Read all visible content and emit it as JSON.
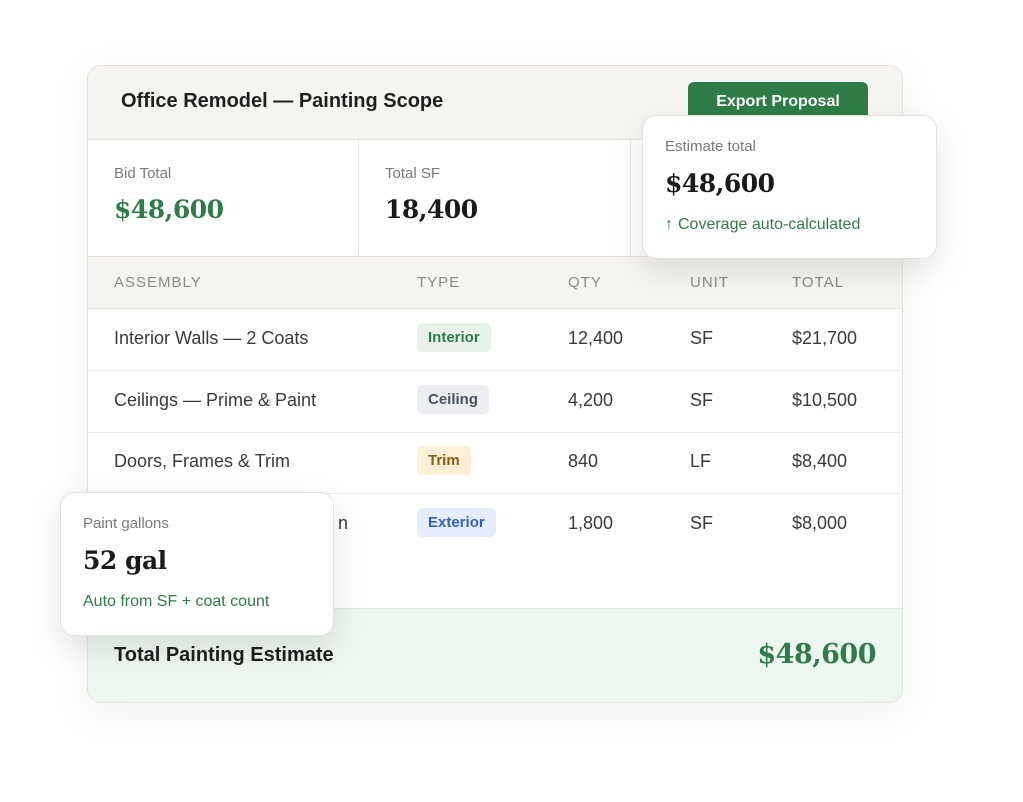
{
  "header": {
    "title": "Office Remodel — Painting Scope",
    "export_label": "Export Proposal"
  },
  "stats": [
    {
      "label": "Bid Total",
      "value": "$48,600"
    },
    {
      "label": "Total SF",
      "value": "18,400"
    }
  ],
  "table": {
    "columns": [
      "ASSEMBLY",
      "TYPE",
      "QTY",
      "UNIT",
      "TOTAL"
    ],
    "rows": [
      {
        "assembly": "Interior Walls — 2 Coats",
        "type": "Interior",
        "qty": "12,400",
        "unit": "SF",
        "total": "$21,700"
      },
      {
        "assembly": "Ceilings — Prime & Paint",
        "type": "Ceiling",
        "qty": "4,200",
        "unit": "SF",
        "total": "$10,500"
      },
      {
        "assembly": "Doors, Frames & Trim",
        "type": "Trim",
        "qty": "840",
        "unit": "LF",
        "total": "$8,400"
      },
      {
        "assembly": "n",
        "type": "Exterior",
        "qty": "1,800",
        "unit": "SF",
        "total": "$8,000"
      }
    ]
  },
  "footer": {
    "label": "Total Painting Estimate",
    "value": "$48,600"
  },
  "estimate_card": {
    "label": "Estimate total",
    "value": "$48,600",
    "note": "Coverage auto-calculated",
    "note_icon": "arrow-up-icon"
  },
  "gallons_card": {
    "label": "Paint gallons",
    "value": "52 gal",
    "note": "Auto from SF + coat count"
  },
  "colors": {
    "accent": "#2e7d46",
    "header_bg": "#f6f4f0",
    "footer_bg": "#edf6ef"
  }
}
